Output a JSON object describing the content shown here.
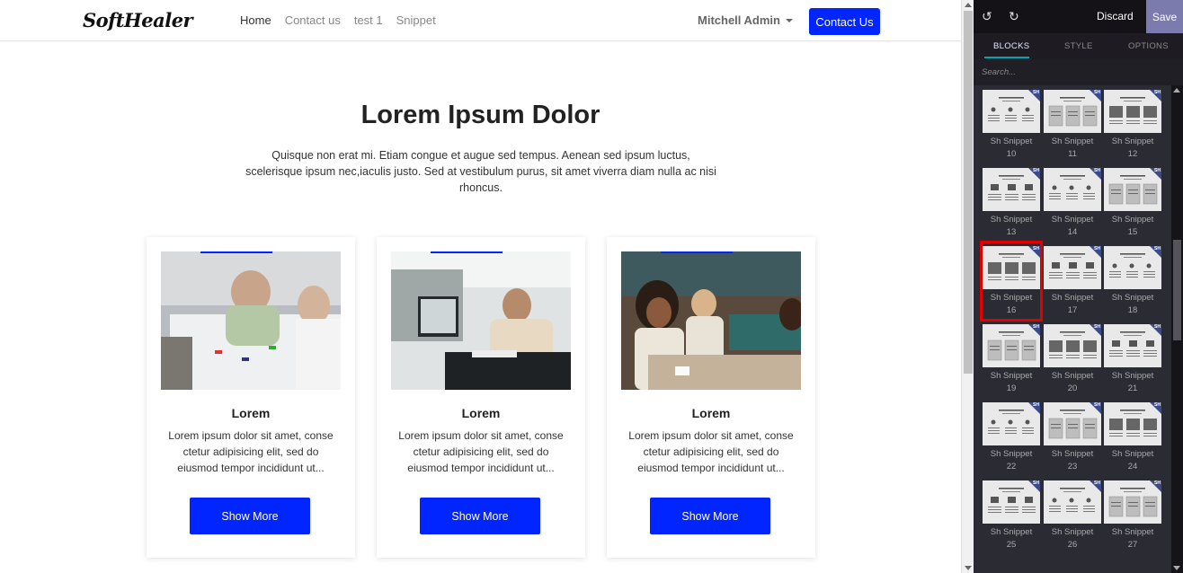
{
  "navbar": {
    "logo": "SoftHealer",
    "links": [
      "Home",
      "Contact us",
      "test 1",
      "Snippet"
    ],
    "user": "Mitchell Admin",
    "contact_button": "Contact Us"
  },
  "hero": {
    "title": "Lorem Ipsum Dolor",
    "text": "Quisque non erat mi. Etiam congue et augue sed tempus. Aenean sed ipsum luctus, scelerisque ipsum nec,iaculis justo. Sed at vestibulum purus, sit amet viverra diam nulla ac nisi rhoncus."
  },
  "cards": [
    {
      "title": "Lorem",
      "text": "Lorem ipsum dolor sit amet, conse ctetur adipisicing elit, sed do eiusmod tempor incididunt ut...",
      "button": "Show More"
    },
    {
      "title": "Lorem",
      "text": "Lorem ipsum dolor sit amet, conse ctetur adipisicing elit, sed do eiusmod tempor incididunt ut...",
      "button": "Show More"
    },
    {
      "title": "Lorem",
      "text": "Lorem ipsum dolor sit amet, conse ctetur adipisicing elit, sed do eiusmod tempor incididunt ut...",
      "button": "Show More"
    }
  ],
  "editor": {
    "discard": "Discard",
    "save": "Save",
    "tabs": [
      "BLOCKS",
      "STYLE",
      "OPTIONS"
    ],
    "active_tab": "BLOCKS",
    "search_placeholder": "Search...",
    "corner_badge": "SH",
    "snippets": [
      {
        "name": "Sh Snippet",
        "num": "10"
      },
      {
        "name": "Sh Snippet",
        "num": "11"
      },
      {
        "name": "Sh Snippet",
        "num": "12"
      },
      {
        "name": "Sh Snippet",
        "num": "13"
      },
      {
        "name": "Sh Snippet",
        "num": "14"
      },
      {
        "name": "Sh Snippet",
        "num": "15"
      },
      {
        "name": "Sh Snippet",
        "num": "16"
      },
      {
        "name": "Sh Snippet",
        "num": "17"
      },
      {
        "name": "Sh Snippet",
        "num": "18"
      },
      {
        "name": "Sh Snippet",
        "num": "19"
      },
      {
        "name": "Sh Snippet",
        "num": "20"
      },
      {
        "name": "Sh Snippet",
        "num": "21"
      },
      {
        "name": "Sh Snippet",
        "num": "22"
      },
      {
        "name": "Sh Snippet",
        "num": "23"
      },
      {
        "name": "Sh Snippet",
        "num": "24"
      },
      {
        "name": "Sh Snippet",
        "num": "25"
      },
      {
        "name": "Sh Snippet",
        "num": "26"
      },
      {
        "name": "Sh Snippet",
        "num": "27"
      }
    ],
    "selected_snippet": "16"
  },
  "colors": {
    "accent": "#0025ff",
    "panel_bg": "#2b2b33",
    "save_bg": "#7c7bad",
    "tab_underline": "#00a6b4",
    "selection": "#e30000"
  }
}
